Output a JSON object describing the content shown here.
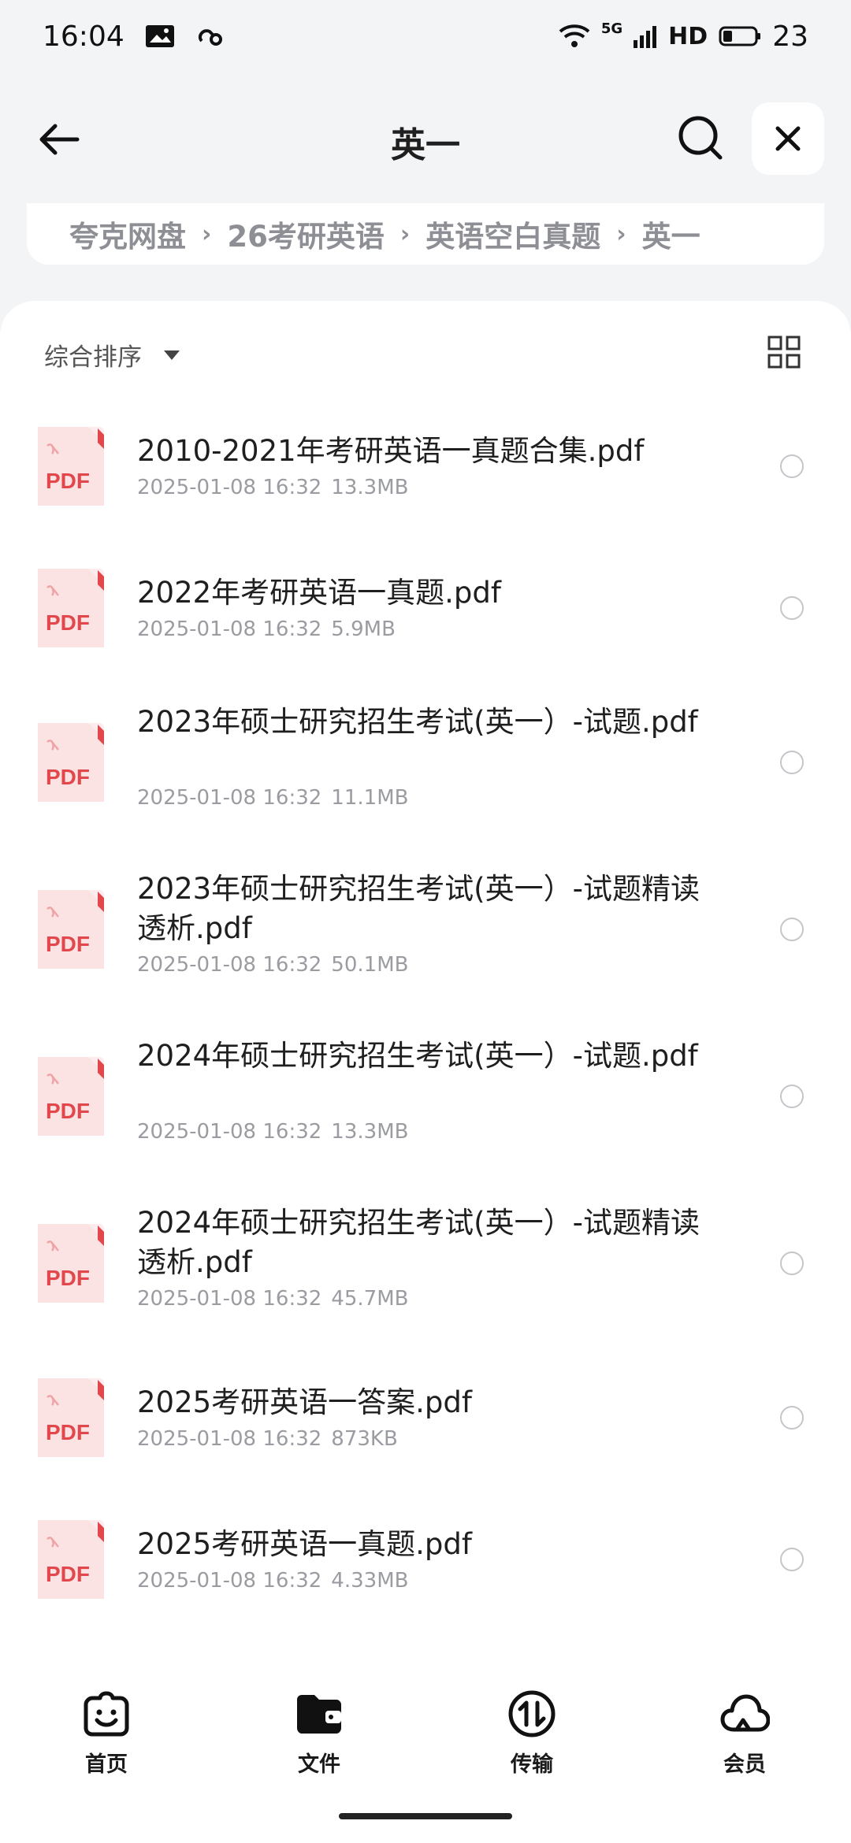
{
  "status_bar": {
    "time": "16:04",
    "network": "5G",
    "hd": "HD",
    "battery": "23",
    "icons": [
      "gallery-icon",
      "link-icon",
      "wifi-icon",
      "signal-icon",
      "battery-icon"
    ]
  },
  "header": {
    "title": "英一",
    "icons": [
      "back-arrow-icon",
      "search-icon",
      "close-icon"
    ]
  },
  "breadcrumb": [
    "夸克网盘",
    "26考研英语",
    "英语空白真题",
    "英一"
  ],
  "toolbar": {
    "sort_label": "综合排序",
    "icons": [
      "caret-down-icon",
      "grid-view-icon"
    ]
  },
  "files": [
    {
      "name": "2010-2021年考研英语一真题合集.pdf",
      "date": "2025-01-08 16:32",
      "size": "13.3MB"
    },
    {
      "name": "2022年考研英语一真题.pdf",
      "date": "2025-01-08 16:32",
      "size": "5.9MB"
    },
    {
      "name": "2023年硕士研究招生考试(英一）-试题.pdf",
      "date": "2025-01-08 16:32",
      "size": "11.1MB"
    },
    {
      "name": "2023年硕士研究招生考试(英一）-试题精读透析.pdf",
      "date": "2025-01-08 16:32",
      "size": "50.1MB"
    },
    {
      "name": "2024年硕士研究招生考试(英一）-试题.pdf",
      "date": "2025-01-08 16:32",
      "size": "13.3MB"
    },
    {
      "name": "2024年硕士研究招生考试(英一）-试题精读透析.pdf",
      "date": "2025-01-08 16:32",
      "size": "45.7MB"
    },
    {
      "name": "2025考研英语一答案.pdf",
      "date": "2025-01-08 16:32",
      "size": "873KB"
    },
    {
      "name": "2025考研英语一真题.pdf",
      "date": "2025-01-08 16:32",
      "size": "4.33MB"
    }
  ],
  "file_icon_label": "PDF",
  "tabs": [
    {
      "label": "首页",
      "icon": "smiley-home-icon"
    },
    {
      "label": "文件",
      "icon": "folder-icon"
    },
    {
      "label": "传输",
      "icon": "transfer-icon"
    },
    {
      "label": "会员",
      "icon": "cloud-member-icon"
    }
  ],
  "colors": {
    "pdf_red": "#e2474b",
    "accent": "#1f1f1f",
    "muted": "#9a9ca1"
  }
}
